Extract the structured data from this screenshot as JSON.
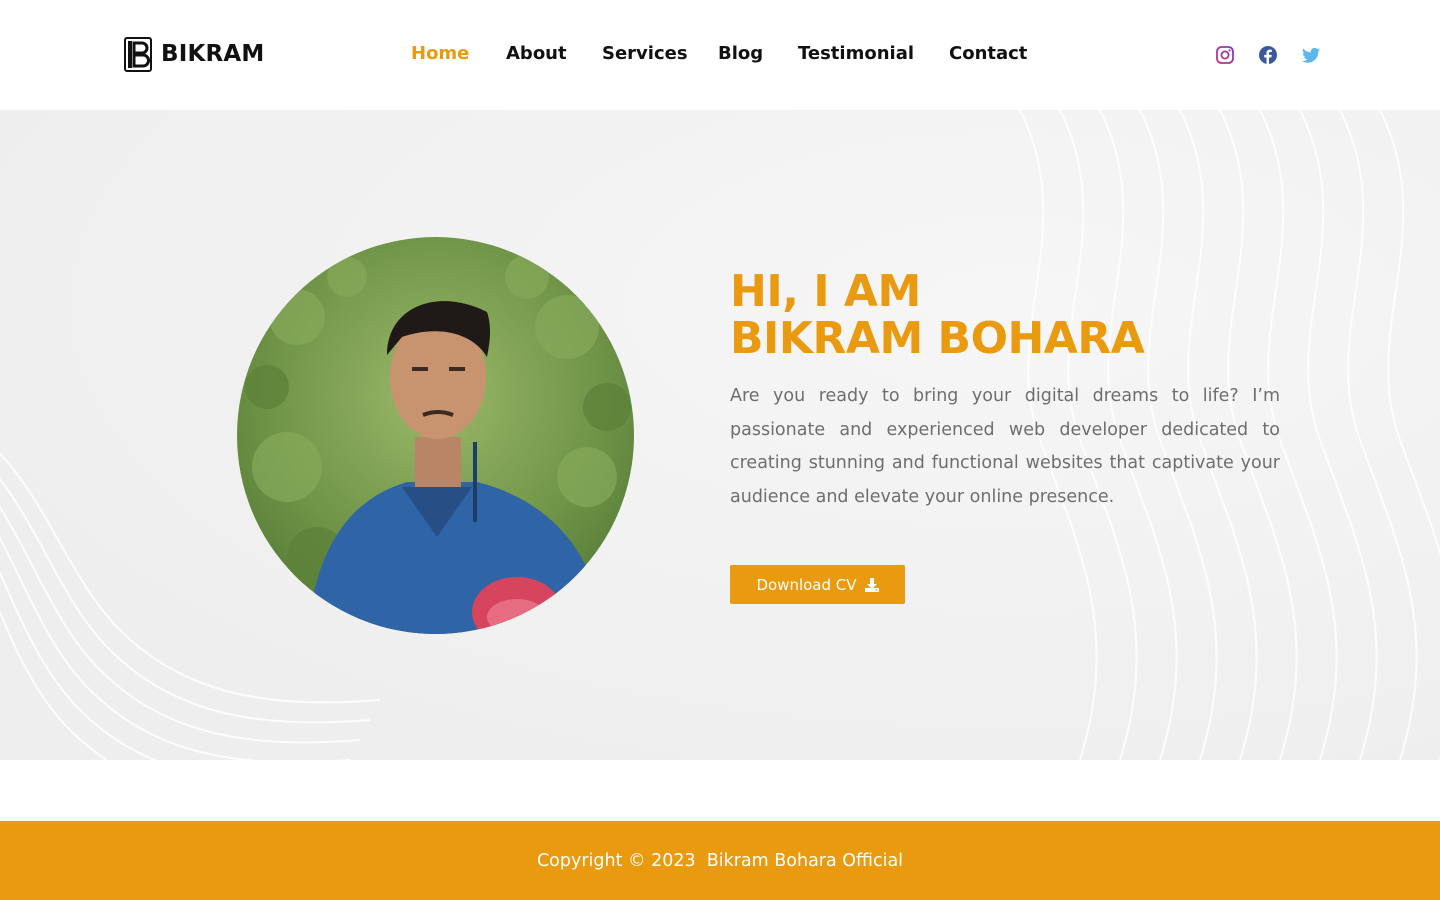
{
  "brand": {
    "name": "BIKRAM"
  },
  "nav": {
    "items": [
      {
        "label": "Home",
        "active": true
      },
      {
        "label": "About",
        "active": false
      },
      {
        "label": "Services",
        "active": false
      },
      {
        "label": "Blog",
        "active": false
      },
      {
        "label": "Testimonial",
        "active": false
      },
      {
        "label": "Contact",
        "active": false
      }
    ]
  },
  "social": [
    {
      "icon": "instagram-icon",
      "color": "#833ab4"
    },
    {
      "icon": "facebook-icon",
      "color": "#3b5998"
    },
    {
      "icon": "twitter-icon",
      "color": "#1da1f2"
    }
  ],
  "hero": {
    "title_line1": "HI, I AM",
    "title_line2": "BIKRAM BOHARA",
    "description": "Are you ready to bring your digital dreams to life? I’m passionate and experienced web developer dedicated to creating stunning and functional websites that captivate your audience and elevate your online presence.",
    "cta_label": "Download CV",
    "cta_icon": "download-icon"
  },
  "footer": {
    "text": "Copyright © 2023  Bikram Bohara Official"
  },
  "colors": {
    "accent": "#e99a0e",
    "text_dark": "#111111",
    "text_muted": "#6e6e6e",
    "hero_bg": "#f1f1f1"
  }
}
